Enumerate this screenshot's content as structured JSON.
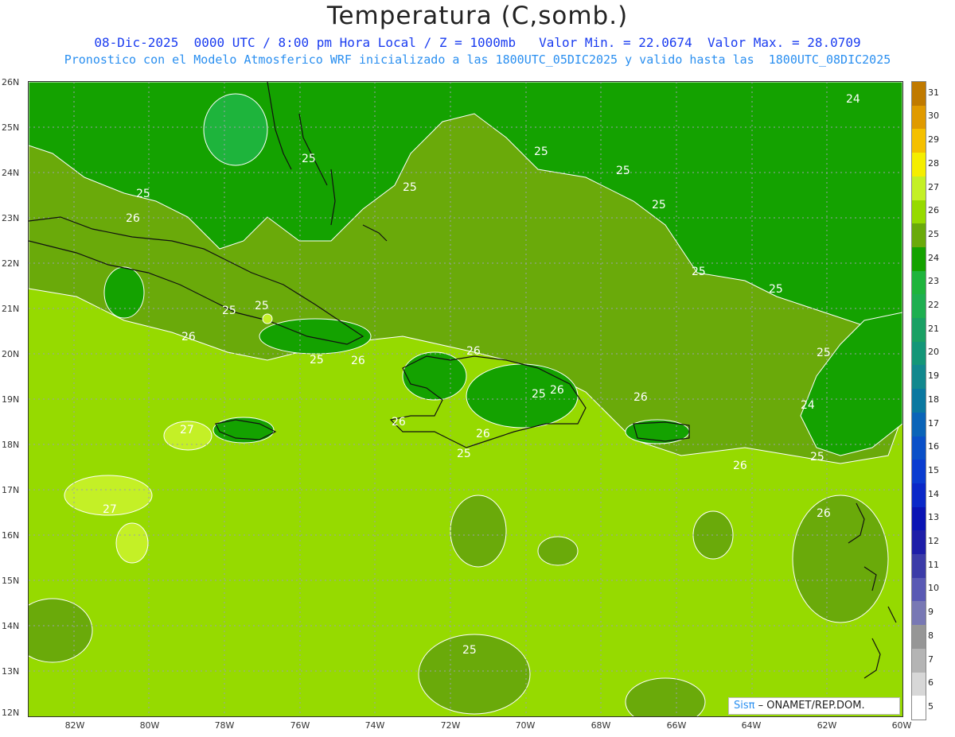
{
  "header": {
    "title": "Temperatura (C,somb.)",
    "subtitle_1": "08-Dic-2025  0000 UTC / 8:00 pm Hora Local / Z = 1000mb   Valor Min. = 22.0674  Valor Max. = 28.0709",
    "subtitle_2": "Pronostico con el Modelo Atmosferico WRF inicializado a las 1800UTC_05DIC2025 y valido hasta las  1800UTC_08DIC2025"
  },
  "axes": {
    "lat_labels": [
      "26N",
      "25N",
      "24N",
      "23N",
      "22N",
      "21N",
      "20N",
      "19N",
      "18N",
      "17N",
      "16N",
      "15N",
      "14N",
      "13N",
      "12N"
    ],
    "lon_labels": [
      "82W",
      "80W",
      "78W",
      "76W",
      "74W",
      "72W",
      "70W",
      "68W",
      "66W",
      "64W",
      "62W",
      "60W"
    ]
  },
  "colorbar": {
    "labels": [
      "31",
      "30",
      "29",
      "28",
      "27",
      "26",
      "25",
      "24",
      "23",
      "22",
      "21",
      "20",
      "19",
      "18",
      "17",
      "16",
      "15",
      "14",
      "13",
      "12",
      "11",
      "10",
      "9",
      "8",
      "7",
      "6",
      "5"
    ],
    "colors": [
      "#c07a00",
      "#e09a00",
      "#f5c000",
      "#f5ee00",
      "#c4f026",
      "#96da00",
      "#6aaa0a",
      "#14a200",
      "#1eb43c",
      "#1eaf50",
      "#1aa064",
      "#149678",
      "#12888e",
      "#0a78a0",
      "#0a64b8",
      "#0a50c8",
      "#0a3cd0",
      "#0a28c8",
      "#0a14b4",
      "#1e1ea8",
      "#3c3ca8",
      "#5a5ab4",
      "#7878b4",
      "#969696",
      "#b4b4b4",
      "#d7d7d7",
      "#ffffff"
    ]
  },
  "contour_labels": [
    "24",
    "25",
    "25",
    "25",
    "25",
    "25",
    "25",
    "25",
    "25",
    "25",
    "25",
    "25",
    "25",
    "25",
    "26",
    "26",
    "26",
    "26",
    "26",
    "26",
    "26",
    "26",
    "26",
    "27",
    "27",
    "24",
    "26",
    "25",
    "25",
    "25"
  ],
  "credit": {
    "brand": "Sisπ",
    "text": "– ONAMET/REP.DOM."
  }
}
